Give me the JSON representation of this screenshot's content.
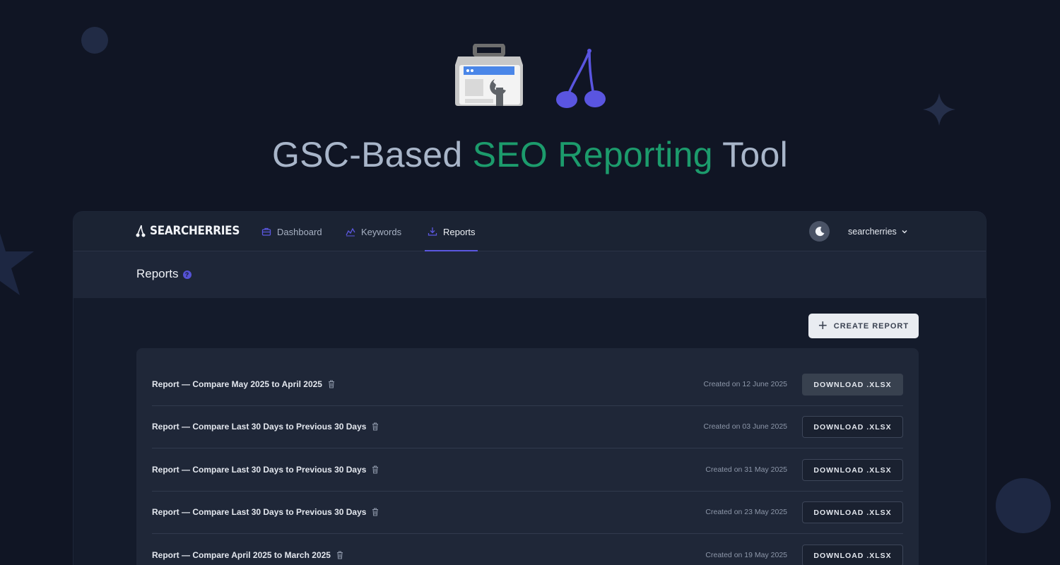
{
  "hero": {
    "title_part1": "GSC-Based ",
    "title_accent": "SEO Reporting",
    "title_part2": " Tool",
    "accent_color": "#1c9b6c"
  },
  "brand": {
    "name": "SEARCHERRIES",
    "icon": "cherry-icon"
  },
  "nav": {
    "items": [
      {
        "label": "Dashboard",
        "icon": "briefcase-icon",
        "active": false
      },
      {
        "label": "Keywords",
        "icon": "trend-chart-icon",
        "active": false
      },
      {
        "label": "Reports",
        "icon": "download-tray-icon",
        "active": true
      }
    ],
    "active_color": "#5b57e0"
  },
  "user": {
    "name": "searcherries",
    "theme_icon": "moon-icon"
  },
  "page": {
    "title": "Reports",
    "help": "?"
  },
  "actions": {
    "create_label": "CREATE REPORT"
  },
  "reports": [
    {
      "name": "Report — Compare May 2025 to April 2025",
      "date": "Created on 12 June 2025",
      "button": "DOWNLOAD .XLSX"
    },
    {
      "name": "Report — Compare Last 30 Days to Previous 30 Days",
      "date": "Created on 03 June 2025",
      "button": "DOWNLOAD .XLSX"
    },
    {
      "name": "Report — Compare Last 30 Days to Previous 30 Days",
      "date": "Created on 31 May 2025",
      "button": "DOWNLOAD .XLSX"
    },
    {
      "name": "Report — Compare Last 30 Days to Previous 30 Days",
      "date": "Created on 23 May 2025",
      "button": "DOWNLOAD .XLSX"
    },
    {
      "name": "Report — Compare April 2025 to March 2025",
      "date": "Created on 19 May 2025",
      "button": "DOWNLOAD .XLSX"
    }
  ]
}
